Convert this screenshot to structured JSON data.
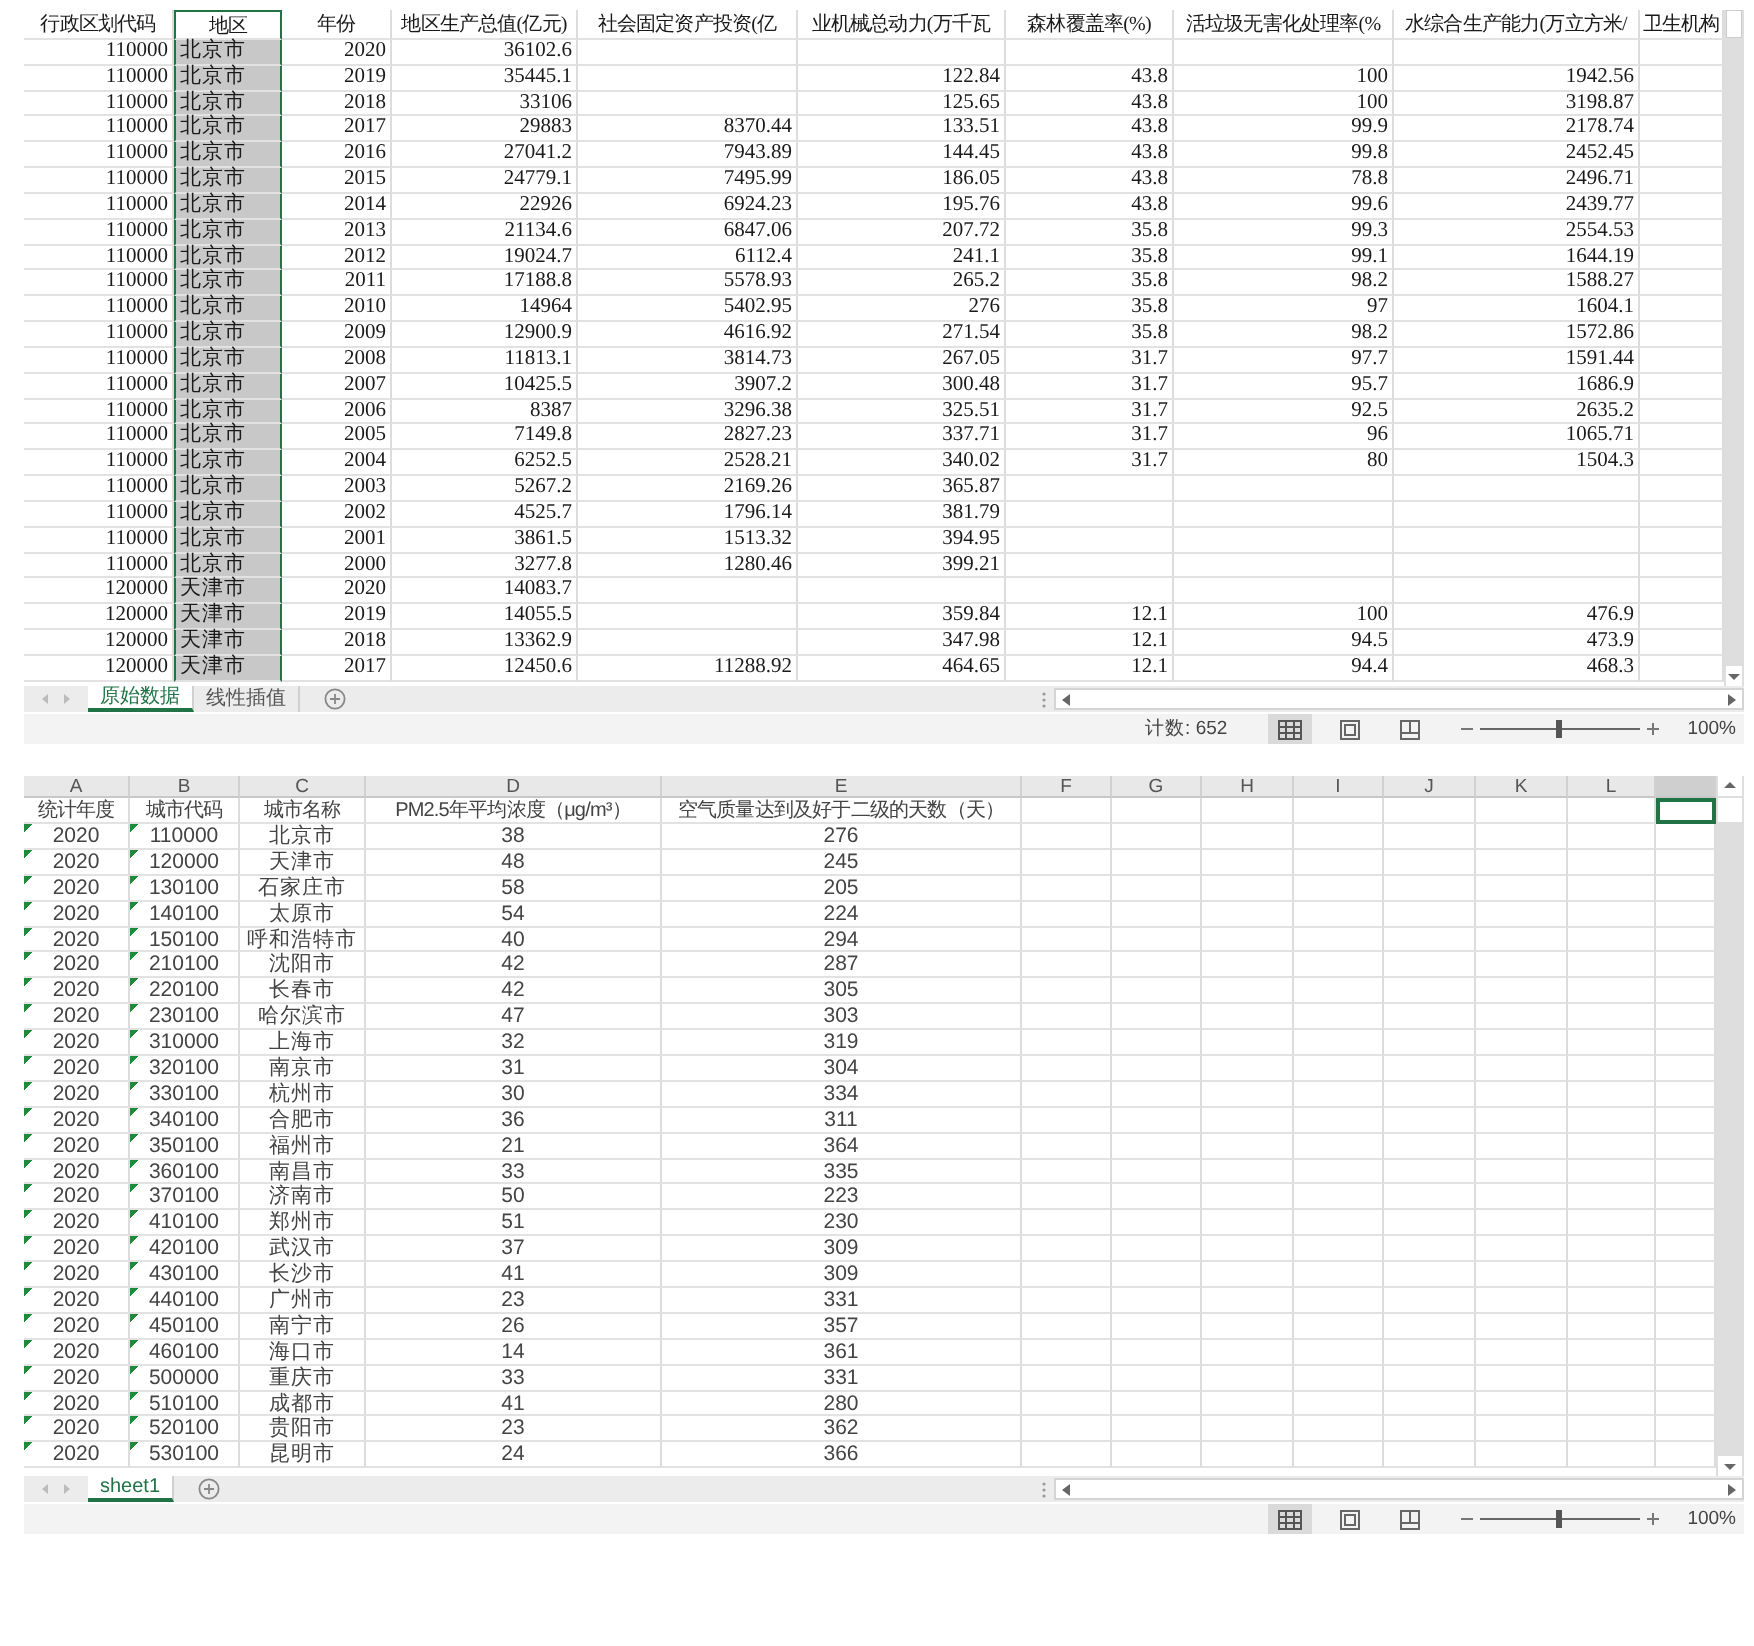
{
  "sheets": [
    {
      "selection": {
        "kind": "column"
      },
      "columns": [
        {
          "header": "行政区划代码",
          "selected": false
        },
        {
          "header": "地区",
          "selected": true
        },
        {
          "header": "年份",
          "selected": false
        },
        {
          "header": "地区生产总值(亿元)",
          "selected": false
        },
        {
          "header": "社会固定资产投资(亿",
          "selected": false
        },
        {
          "header": "业机械总动力(万千瓦",
          "selected": false
        },
        {
          "header": "森林覆盖率(%)",
          "selected": false
        },
        {
          "header": "活垃圾无害化处理率(%",
          "selected": false
        },
        {
          "header": "水综合生产能力(万立方米/",
          "selected": false
        },
        {
          "header": "卫生机构",
          "selected": false
        }
      ],
      "rows": [
        [
          "110000",
          "北京市",
          "2020",
          "36102.6"
        ],
        [
          "110000",
          "北京市",
          "2019",
          "35445.1",
          null,
          "122.84",
          "43.8",
          "100",
          "1942.56"
        ],
        [
          "110000",
          "北京市",
          "2018",
          "33106",
          null,
          "125.65",
          "43.8",
          "100",
          "3198.87"
        ],
        [
          "110000",
          "北京市",
          "2017",
          "29883",
          "8370.44",
          "133.51",
          "43.8",
          "99.9",
          "2178.74"
        ],
        [
          "110000",
          "北京市",
          "2016",
          "27041.2",
          "7943.89",
          "144.45",
          "43.8",
          "99.8",
          "2452.45"
        ],
        [
          "110000",
          "北京市",
          "2015",
          "24779.1",
          "7495.99",
          "186.05",
          "43.8",
          "78.8",
          "2496.71"
        ],
        [
          "110000",
          "北京市",
          "2014",
          "22926",
          "6924.23",
          "195.76",
          "43.8",
          "99.6",
          "2439.77"
        ],
        [
          "110000",
          "北京市",
          "2013",
          "21134.6",
          "6847.06",
          "207.72",
          "35.8",
          "99.3",
          "2554.53"
        ],
        [
          "110000",
          "北京市",
          "2012",
          "19024.7",
          "6112.4",
          "241.1",
          "35.8",
          "99.1",
          "1644.19"
        ],
        [
          "110000",
          "北京市",
          "2011",
          "17188.8",
          "5578.93",
          "265.2",
          "35.8",
          "98.2",
          "1588.27"
        ],
        [
          "110000",
          "北京市",
          "2010",
          "14964",
          "5402.95",
          "276",
          "35.8",
          "97",
          "1604.1"
        ],
        [
          "110000",
          "北京市",
          "2009",
          "12900.9",
          "4616.92",
          "271.54",
          "35.8",
          "98.2",
          "1572.86"
        ],
        [
          "110000",
          "北京市",
          "2008",
          "11813.1",
          "3814.73",
          "267.05",
          "31.7",
          "97.7",
          "1591.44"
        ],
        [
          "110000",
          "北京市",
          "2007",
          "10425.5",
          "3907.2",
          "300.48",
          "31.7",
          "95.7",
          "1686.9"
        ],
        [
          "110000",
          "北京市",
          "2006",
          "8387",
          "3296.38",
          "325.51",
          "31.7",
          "92.5",
          "2635.2"
        ],
        [
          "110000",
          "北京市",
          "2005",
          "7149.8",
          "2827.23",
          "337.71",
          "31.7",
          "96",
          "1065.71"
        ],
        [
          "110000",
          "北京市",
          "2004",
          "6252.5",
          "2528.21",
          "340.02",
          "31.7",
          "80",
          "1504.3"
        ],
        [
          "110000",
          "北京市",
          "2003",
          "5267.2",
          "2169.26",
          "365.87"
        ],
        [
          "110000",
          "北京市",
          "2002",
          "4525.7",
          "1796.14",
          "381.79"
        ],
        [
          "110000",
          "北京市",
          "2001",
          "3861.5",
          "1513.32",
          "394.95"
        ],
        [
          "110000",
          "北京市",
          "2000",
          "3277.8",
          "1280.46",
          "399.21"
        ],
        [
          "120000",
          "天津市",
          "2020",
          "14083.7"
        ],
        [
          "120000",
          "天津市",
          "2019",
          "14055.5",
          null,
          "359.84",
          "12.1",
          "100",
          "476.9"
        ],
        [
          "120000",
          "天津市",
          "2018",
          "13362.9",
          null,
          "347.98",
          "12.1",
          "94.5",
          "473.9"
        ],
        [
          "120000",
          "天津市",
          "2017",
          "12450.6",
          "11288.92",
          "464.65",
          "12.1",
          "94.4",
          "468.3"
        ]
      ],
      "tabs": [
        {
          "label": "原始数据",
          "selected": true
        },
        {
          "label": "线性插值",
          "selected": false
        }
      ],
      "status": {
        "count": "计数: 652",
        "views": [
          {
            "selected": true
          },
          {
            "selected": false
          },
          {
            "selected": false
          }
        ],
        "zoom": {
          "level": 0.5,
          "label": "100%"
        }
      }
    },
    {
      "selection": {
        "kind": "cell"
      },
      "columns": [
        {
          "letter": "A",
          "header": "统计年度",
          "flagged": true,
          "selected": false
        },
        {
          "letter": "B",
          "header": "城市代码",
          "flagged": true,
          "selected": false
        },
        {
          "letter": "C",
          "header": "城市名称",
          "flagged": false,
          "selected": false
        },
        {
          "letter": "D",
          "header": "PM2.5年平均浓度（μg/m³）",
          "flagged": false,
          "selected": false
        },
        {
          "letter": "E",
          "header": "空气质量达到及好于二级的天数（天）",
          "flagged": false,
          "selected": false
        },
        {
          "letter": "F",
          "flagged": false,
          "selected": false
        },
        {
          "letter": "G",
          "flagged": false,
          "selected": false
        },
        {
          "letter": "H",
          "flagged": false,
          "selected": false
        },
        {
          "letter": "I",
          "flagged": false,
          "selected": false
        },
        {
          "letter": "J",
          "flagged": false,
          "selected": false
        },
        {
          "letter": "K",
          "flagged": false,
          "selected": false
        },
        {
          "letter": "L",
          "flagged": false,
          "selected": false
        },
        {
          "flagged": false,
          "selected": true
        }
      ],
      "rows": [
        [
          "2020",
          "110000",
          "北京市",
          "38",
          "276"
        ],
        [
          "2020",
          "120000",
          "天津市",
          "48",
          "245"
        ],
        [
          "2020",
          "130100",
          "石家庄市",
          "58",
          "205"
        ],
        [
          "2020",
          "140100",
          "太原市",
          "54",
          "224"
        ],
        [
          "2020",
          "150100",
          "呼和浩特市",
          "40",
          "294"
        ],
        [
          "2020",
          "210100",
          "沈阳市",
          "42",
          "287"
        ],
        [
          "2020",
          "220100",
          "长春市",
          "42",
          "305"
        ],
        [
          "2020",
          "230100",
          "哈尔滨市",
          "47",
          "303"
        ],
        [
          "2020",
          "310000",
          "上海市",
          "32",
          "319"
        ],
        [
          "2020",
          "320100",
          "南京市",
          "31",
          "304"
        ],
        [
          "2020",
          "330100",
          "杭州市",
          "30",
          "334"
        ],
        [
          "2020",
          "340100",
          "合肥市",
          "36",
          "311"
        ],
        [
          "2020",
          "350100",
          "福州市",
          "21",
          "364"
        ],
        [
          "2020",
          "360100",
          "南昌市",
          "33",
          "335"
        ],
        [
          "2020",
          "370100",
          "济南市",
          "50",
          "223"
        ],
        [
          "2020",
          "410100",
          "郑州市",
          "51",
          "230"
        ],
        [
          "2020",
          "420100",
          "武汉市",
          "37",
          "309"
        ],
        [
          "2020",
          "430100",
          "长沙市",
          "41",
          "309"
        ],
        [
          "2020",
          "440100",
          "广州市",
          "23",
          "331"
        ],
        [
          "2020",
          "450100",
          "南宁市",
          "26",
          "357"
        ],
        [
          "2020",
          "460100",
          "海口市",
          "14",
          "361"
        ],
        [
          "2020",
          "500000",
          "重庆市",
          "33",
          "331"
        ],
        [
          "2020",
          "510100",
          "成都市",
          "41",
          "280"
        ],
        [
          "2020",
          "520100",
          "贵阳市",
          "23",
          "362"
        ],
        [
          "2020",
          "530100",
          "昆明市",
          "24",
          "366"
        ]
      ],
      "tabs": [
        {
          "label": "sheet1",
          "selected": true
        }
      ],
      "status": {
        "views": [
          {
            "selected": true
          },
          {
            "selected": false
          },
          {
            "selected": false
          }
        ],
        "zoom": {
          "level": 0.5,
          "label": "100%"
        }
      }
    }
  ]
}
